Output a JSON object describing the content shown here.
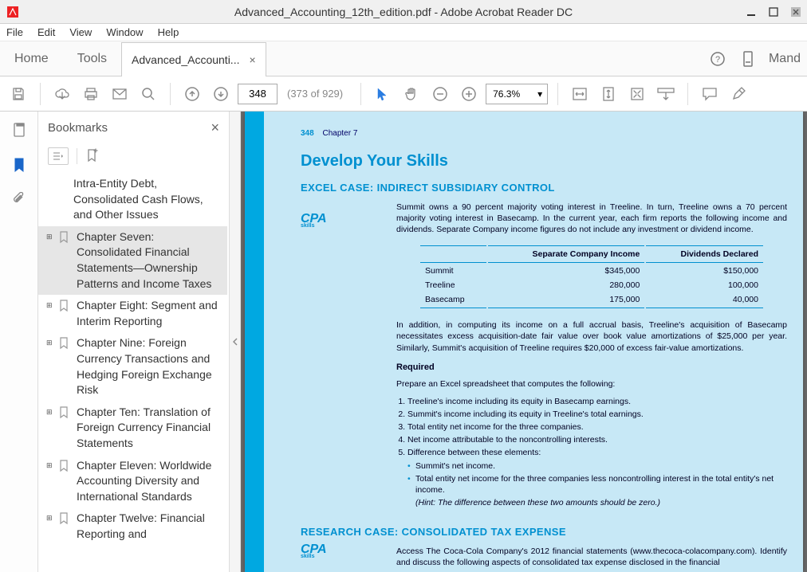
{
  "window": {
    "title": "Advanced_Accounting_12th_edition.pdf - Adobe Acrobat Reader DC"
  },
  "menubar": [
    "File",
    "Edit",
    "View",
    "Window",
    "Help"
  ],
  "tabs": {
    "home": "Home",
    "tools": "Tools",
    "doc": "Advanced_Accounti...",
    "mand": "Mand"
  },
  "toolbar": {
    "page_current": "348",
    "page_info": "(373 of 929)",
    "zoom": "76.3%"
  },
  "bookmarks": {
    "title": "Bookmarks",
    "items": [
      {
        "label": "Intra-Entity Debt, Consolidated Cash Flows, and Other Issues",
        "expand": false,
        "active": false,
        "indent": true
      },
      {
        "label": "Chapter Seven: Consolidated Financial Statements—Ownership Patterns and Income Taxes",
        "expand": true,
        "active": true
      },
      {
        "label": "Chapter Eight: Segment and Interim Reporting",
        "expand": true,
        "active": false
      },
      {
        "label": "Chapter Nine: Foreign Currency Transactions and Hedging Foreign Exchange Risk",
        "expand": true,
        "active": false
      },
      {
        "label": "Chapter Ten: Translation of Foreign Currency Financial Statements",
        "expand": true,
        "active": false
      },
      {
        "label": "Chapter Eleven: Worldwide Accounting Diversity and International Standards",
        "expand": true,
        "active": false
      },
      {
        "label": "Chapter Twelve: Financial Reporting and",
        "expand": true,
        "active": false
      }
    ]
  },
  "doc": {
    "page_number": "348",
    "chapter_label": "Chapter 7",
    "h2": "Develop Your Skills",
    "excel_case_title": "EXCEL CASE: INDIRECT SUBSIDIARY CONTROL",
    "cpa": "CPA",
    "cpa_sub": "skills",
    "intro": "Summit owns a 90 percent majority voting interest in Treeline. In turn, Treeline owns a 70 percent majority voting interest in Basecamp. In the current year, each firm reports the following income and dividends. Separate Company income figures do not include any investment or dividend income.",
    "table": {
      "headers": [
        "",
        "Separate Company Income",
        "Dividends Declared"
      ],
      "rows": [
        [
          "Summit",
          "$345,000",
          "$150,000"
        ],
        [
          "Treeline",
          "280,000",
          "100,000"
        ],
        [
          "Basecamp",
          "175,000",
          "40,000"
        ]
      ]
    },
    "para2": "In addition, in computing its income on a full accrual basis, Treeline's acquisition of Basecamp necessitates excess acquisition-date fair value over book value amortizations of $25,000 per year. Similarly, Summit's acquisition of Treeline requires $20,000 of excess fair-value amortizations.",
    "required_label": "Required",
    "required_intro": "Prepare an Excel spreadsheet that computes the following:",
    "required_list": [
      "Treeline's income including its equity in Basecamp earnings.",
      "Summit's income including its equity in Treeline's total earnings.",
      "Total entity net income for the three companies.",
      "Net income attributable to the noncontrolling interests.",
      "Difference between these elements:"
    ],
    "sublist": [
      "Summit's net income.",
      "Total entity net income for the three companies less noncontrolling interest in the total entity's net income."
    ],
    "hint": "(Hint: The difference between these two amounts should be zero.)",
    "research_title": "RESEARCH CASE: CONSOLIDATED TAX EXPENSE",
    "research_para": "Access The Coca-Cola Company's 2012 financial statements (www.thecoca-colacompany.com). Identify and discuss the following aspects of consolidated tax expense disclosed in the financial"
  }
}
